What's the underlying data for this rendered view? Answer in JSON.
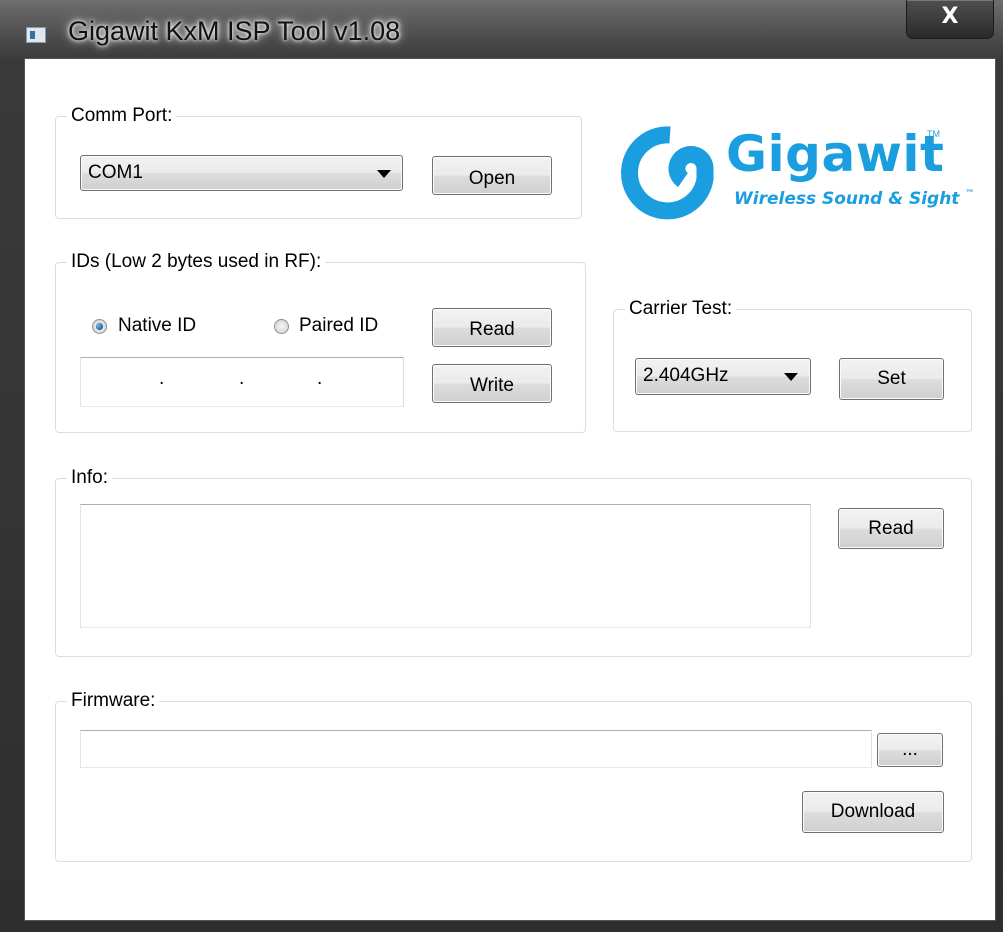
{
  "window": {
    "title": "Gigawit KxM ISP Tool v1.08",
    "close_glyph": "X"
  },
  "comm_port": {
    "label": "Comm Port:",
    "selected": "COM1",
    "open_button": "Open"
  },
  "logo": {
    "brand": "Gigawit",
    "trademark": "TM",
    "tagline": "Wireless Sound & Sight",
    "tagline_tm": "™",
    "color": "#1a9ee0",
    "icon": "swirl-logo-icon"
  },
  "ids": {
    "label": "IDs (Low 2 bytes used in RF):",
    "native_label": "Native ID",
    "paired_label": "Paired ID",
    "selected": "native",
    "read_button": "Read",
    "write_button": "Write",
    "separator": "."
  },
  "carrier_test": {
    "label": "Carrier Test:",
    "selected": "2.404GHz",
    "set_button": "Set"
  },
  "info": {
    "label": "Info:",
    "read_button": "Read",
    "text": ""
  },
  "firmware": {
    "label": "Firmware:",
    "path": "",
    "browse_button": "...",
    "download_button": "Download"
  }
}
